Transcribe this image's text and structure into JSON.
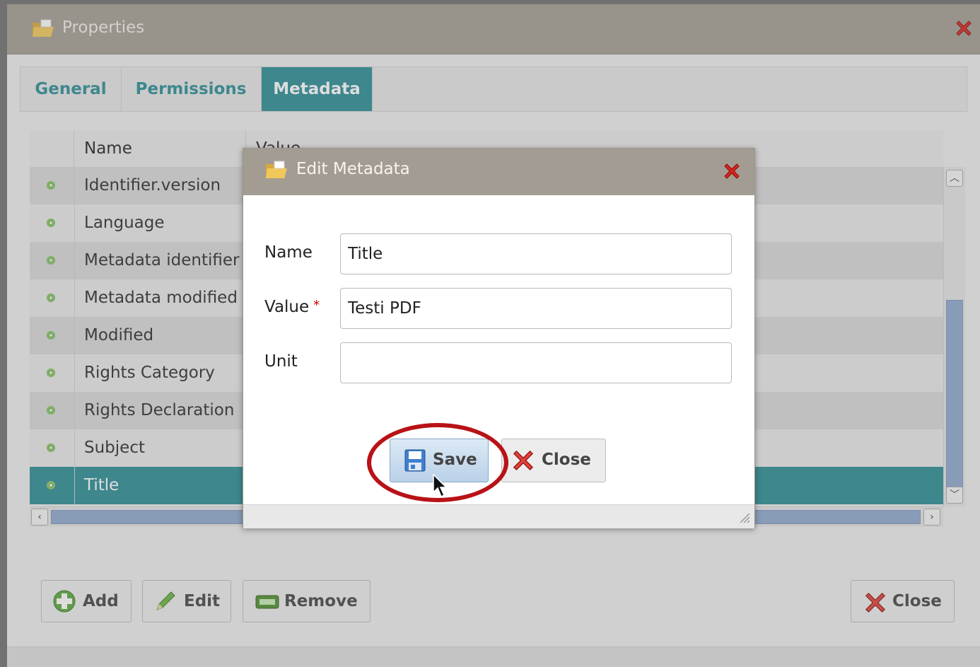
{
  "properties_window": {
    "title": "Properties",
    "close_icon": "close-red-x-icon",
    "tabs": [
      {
        "label": "General",
        "active": false
      },
      {
        "label": "Permissions",
        "active": false
      },
      {
        "label": "Metadata",
        "active": true
      }
    ],
    "grid": {
      "columns": [
        "Name",
        "Value"
      ],
      "rows": [
        {
          "name": "Identifier.version"
        },
        {
          "name": "Language"
        },
        {
          "name": "Metadata identifier"
        },
        {
          "name": "Metadata modified"
        },
        {
          "name": "Modified"
        },
        {
          "name": "Rights Category"
        },
        {
          "name": "Rights Declaration"
        },
        {
          "name": "Subject"
        },
        {
          "name": "Title",
          "selected": true
        }
      ]
    },
    "buttons": {
      "add": "Add",
      "edit": "Edit",
      "remove": "Remove",
      "close": "Close"
    }
  },
  "edit_dialog": {
    "title": "Edit Metadata",
    "fields": {
      "name_label": "Name",
      "name_value": "Title",
      "value_label": "Value",
      "value_value": "Testi PDF",
      "unit_label": "Unit",
      "unit_value": ""
    },
    "save_label": "Save",
    "close_label": "Close"
  },
  "colors": {
    "accent": "#2a8d95",
    "title_bar": "#a39c92",
    "highlight_ring": "#b81217"
  }
}
